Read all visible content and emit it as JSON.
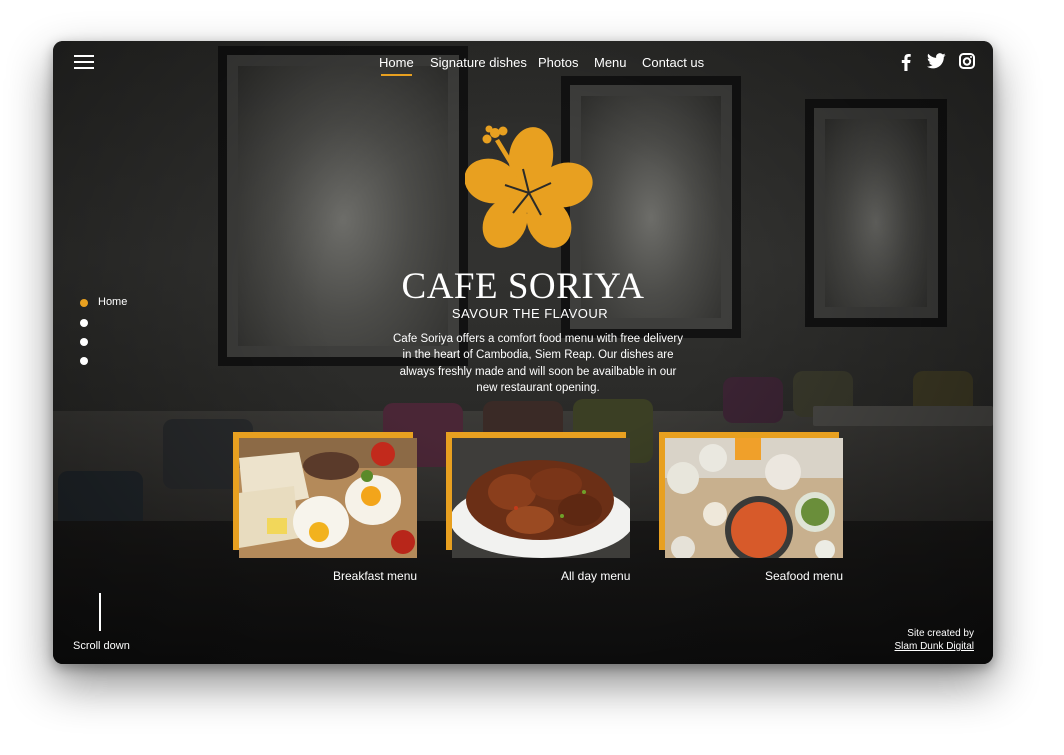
{
  "nav": {
    "items": [
      {
        "label": "Home",
        "active": true
      },
      {
        "label": "Signature dishes",
        "active": false
      },
      {
        "label": "Photos",
        "active": false
      },
      {
        "label": "Menu",
        "active": false
      },
      {
        "label": "Contact us",
        "active": false
      }
    ]
  },
  "social": {
    "icons": [
      "facebook-icon",
      "twitter-icon",
      "instagram-icon"
    ]
  },
  "hero": {
    "title": "CAFE SORIYA",
    "subtitle": "SAVOUR THE FLAVOUR",
    "description": "Cafe Soriya offers a comfort food menu with free delivery in the heart of Cambodia, Siem Reap. Our dishes are always freshly made and will soon be availbable in our new restaurant opening."
  },
  "side_nav": {
    "active_label": "Home",
    "dot_count": 4,
    "active_index": 0
  },
  "menus": [
    {
      "label": "Breakfast menu"
    },
    {
      "label": "All day menu"
    },
    {
      "label": "Seafood menu"
    }
  ],
  "footer": {
    "scroll_label": "Scroll down",
    "credit_text": "Site created by",
    "credit_link": "Slam Dunk Digital"
  },
  "colors": {
    "accent": "#e8a020",
    "text": "#ffffff",
    "background": "#1e1e1d"
  }
}
